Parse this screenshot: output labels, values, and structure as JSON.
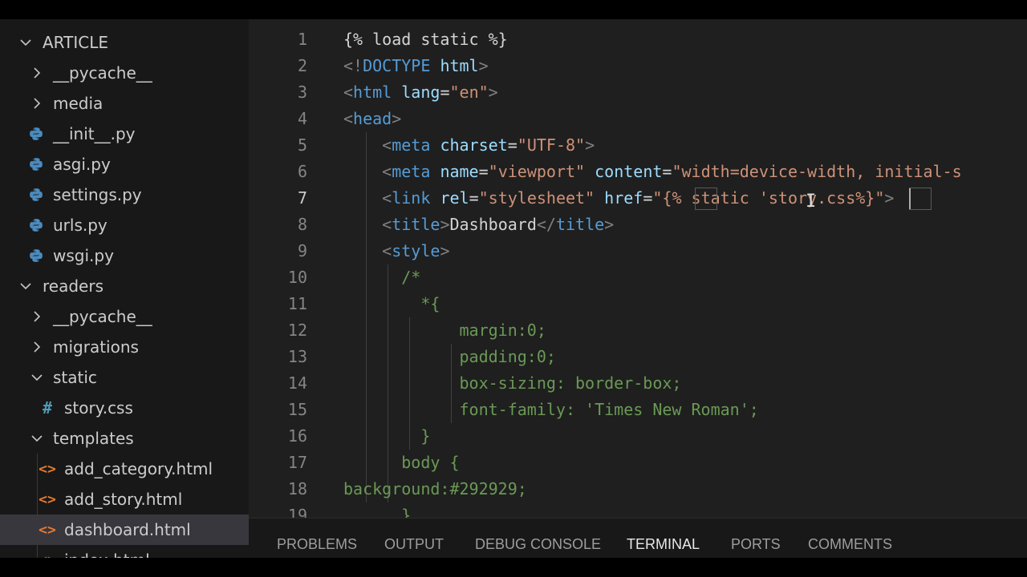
{
  "explorer": {
    "items": [
      {
        "label": "ARTICLE",
        "kind": "folder-open",
        "level": 0
      },
      {
        "label": "__pycache__",
        "kind": "folder-closed",
        "level": 1
      },
      {
        "label": "media",
        "kind": "folder-closed",
        "level": 1
      },
      {
        "label": "__init__.py",
        "kind": "python",
        "level": 1
      },
      {
        "label": "asgi.py",
        "kind": "python",
        "level": 1
      },
      {
        "label": "settings.py",
        "kind": "python",
        "level": 1
      },
      {
        "label": "urls.py",
        "kind": "python",
        "level": 1
      },
      {
        "label": "wsgi.py",
        "kind": "python",
        "level": 1
      },
      {
        "label": "readers",
        "kind": "folder-open",
        "level": 0
      },
      {
        "label": "__pycache__",
        "kind": "folder-closed",
        "level": 1
      },
      {
        "label": "migrations",
        "kind": "folder-closed",
        "level": 1
      },
      {
        "label": "static",
        "kind": "folder-open",
        "level": 1
      },
      {
        "label": "story.css",
        "kind": "css",
        "level": 2
      },
      {
        "label": "templates",
        "kind": "folder-open",
        "level": 1
      },
      {
        "label": "add_category.html",
        "kind": "html",
        "level": 2
      },
      {
        "label": "add_story.html",
        "kind": "html",
        "level": 2
      },
      {
        "label": "dashboard.html",
        "kind": "html",
        "level": 2,
        "selected": true
      },
      {
        "label": "index.html",
        "kind": "html",
        "level": 2
      }
    ]
  },
  "editor": {
    "active_line": 7,
    "lines": [
      {
        "n": "1",
        "tokens": [
          [
            "c-tpl",
            "{% load static %}"
          ]
        ]
      },
      {
        "n": "2",
        "tokens": [
          [
            "c-punct",
            "<!"
          ],
          [
            "c-tag",
            "DOCTYPE"
          ],
          [
            "c-text",
            " "
          ],
          [
            "c-attr",
            "html"
          ],
          [
            "c-punct",
            ">"
          ]
        ]
      },
      {
        "n": "3",
        "tokens": [
          [
            "c-punct",
            "<"
          ],
          [
            "c-tag",
            "html"
          ],
          [
            "c-text",
            " "
          ],
          [
            "c-attr",
            "lang"
          ],
          [
            "c-text",
            "="
          ],
          [
            "c-str",
            "\"en\""
          ],
          [
            "c-punct",
            ">"
          ]
        ]
      },
      {
        "n": "4",
        "tokens": [
          [
            "c-punct",
            "<"
          ],
          [
            "c-tag",
            "head"
          ],
          [
            "c-punct",
            ">"
          ]
        ]
      },
      {
        "n": "5",
        "tokens": [
          [
            "c-text",
            "    "
          ],
          [
            "c-punct",
            "<"
          ],
          [
            "c-tag",
            "meta"
          ],
          [
            "c-text",
            " "
          ],
          [
            "c-attr",
            "charset"
          ],
          [
            "c-text",
            "="
          ],
          [
            "c-str",
            "\"UTF-8\""
          ],
          [
            "c-punct",
            ">"
          ]
        ]
      },
      {
        "n": "6",
        "tokens": [
          [
            "c-text",
            "    "
          ],
          [
            "c-punct",
            "<"
          ],
          [
            "c-tag",
            "meta"
          ],
          [
            "c-text",
            " "
          ],
          [
            "c-attr",
            "name"
          ],
          [
            "c-text",
            "="
          ],
          [
            "c-str",
            "\"viewport\""
          ],
          [
            "c-text",
            " "
          ],
          [
            "c-attr",
            "content"
          ],
          [
            "c-text",
            "="
          ],
          [
            "c-str",
            "\"width=device-width, initial-s"
          ]
        ]
      },
      {
        "n": "7",
        "tokens": [
          [
            "c-text",
            "    "
          ],
          [
            "c-punct",
            "<"
          ],
          [
            "c-tag",
            "link"
          ],
          [
            "c-text",
            " "
          ],
          [
            "c-attr",
            "rel"
          ],
          [
            "c-text",
            "="
          ],
          [
            "c-str",
            "\"stylesheet\""
          ],
          [
            "c-text",
            " "
          ],
          [
            "c-attr",
            "href"
          ],
          [
            "c-text",
            "="
          ],
          [
            "c-str",
            "\"{% static 'story.css%}\""
          ],
          [
            "c-punct",
            ">"
          ]
        ]
      },
      {
        "n": "8",
        "tokens": [
          [
            "c-text",
            "    "
          ],
          [
            "c-punct",
            "<"
          ],
          [
            "c-tag",
            "title"
          ],
          [
            "c-punct",
            ">"
          ],
          [
            "c-text",
            "Dashboard"
          ],
          [
            "c-punct",
            "</"
          ],
          [
            "c-tag",
            "title"
          ],
          [
            "c-punct",
            ">"
          ]
        ]
      },
      {
        "n": "9",
        "tokens": [
          [
            "c-text",
            "    "
          ],
          [
            "c-punct",
            "<"
          ],
          [
            "c-tag",
            "style"
          ],
          [
            "c-punct",
            ">"
          ]
        ]
      },
      {
        "n": "10",
        "tokens": [
          [
            "c-text",
            "      "
          ],
          [
            "c-com",
            "/*"
          ]
        ]
      },
      {
        "n": "11",
        "tokens": [
          [
            "c-text",
            "        "
          ],
          [
            "c-com",
            "*{"
          ]
        ]
      },
      {
        "n": "12",
        "tokens": [
          [
            "c-text",
            "            "
          ],
          [
            "c-com",
            "margin:0;"
          ]
        ]
      },
      {
        "n": "13",
        "tokens": [
          [
            "c-text",
            "            "
          ],
          [
            "c-com",
            "padding:0;"
          ]
        ]
      },
      {
        "n": "14",
        "tokens": [
          [
            "c-text",
            "            "
          ],
          [
            "c-com",
            "box-sizing: border-box;"
          ]
        ]
      },
      {
        "n": "15",
        "tokens": [
          [
            "c-text",
            "            "
          ],
          [
            "c-com",
            "font-family: 'Times New Roman';"
          ]
        ]
      },
      {
        "n": "16",
        "tokens": [
          [
            "c-text",
            "        "
          ],
          [
            "c-com",
            "}"
          ]
        ]
      },
      {
        "n": "17",
        "tokens": [
          [
            "c-text",
            "      "
          ],
          [
            "c-com",
            "body {"
          ]
        ]
      },
      {
        "n": "18",
        "tokens": [
          [
            "c-com",
            "background:#292929;"
          ]
        ]
      },
      {
        "n": "19",
        "tokens": [
          [
            "c-text",
            "      "
          ],
          [
            "c-com",
            "}"
          ]
        ]
      }
    ]
  },
  "panel": {
    "tabs": [
      {
        "label": "PROBLEMS",
        "active": false
      },
      {
        "label": "OUTPUT",
        "active": false
      },
      {
        "label": "DEBUG CONSOLE",
        "active": false
      },
      {
        "label": "TERMINAL",
        "active": true
      },
      {
        "label": "PORTS",
        "active": false
      },
      {
        "label": "COMMENTS",
        "active": false
      }
    ]
  },
  "colors": {
    "python_icon": "#4b8bbe",
    "css_icon": "#519aba",
    "html_icon": "#e37933",
    "selection_bg": "#37373d"
  }
}
